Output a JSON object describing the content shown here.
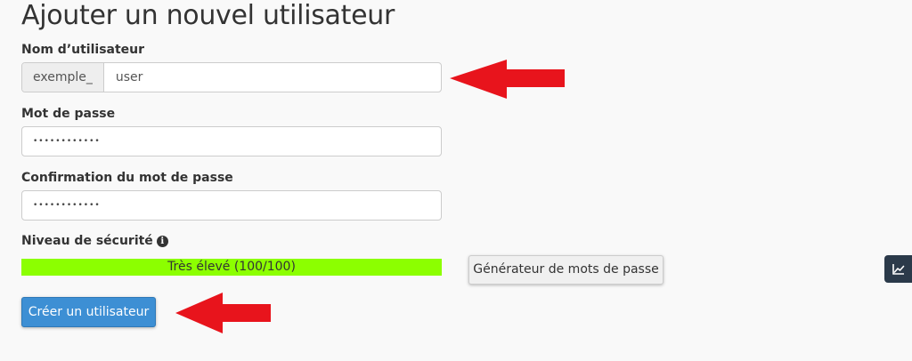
{
  "page_title": "Ajouter un nouvel utilisateur",
  "username": {
    "label": "Nom d’utilisateur",
    "prefix": "exemple_",
    "value": "user"
  },
  "password": {
    "label": "Mot de passe",
    "value": "••••••••••••"
  },
  "confirm_password": {
    "label": "Confirmation du mot de passe",
    "value": "••••••••••••"
  },
  "security": {
    "label": "Niveau de sécurité",
    "info_icon": "info-circle-icon",
    "meter_text": "Très élevé (100/100)",
    "score": 100,
    "meter_color": "#8cff00"
  },
  "generator_button": "Générateur de mots de passe",
  "create_button": "Créer un utilisateur",
  "side_widget_icon": "line-chart-icon",
  "annotation_color": "#e8141c"
}
